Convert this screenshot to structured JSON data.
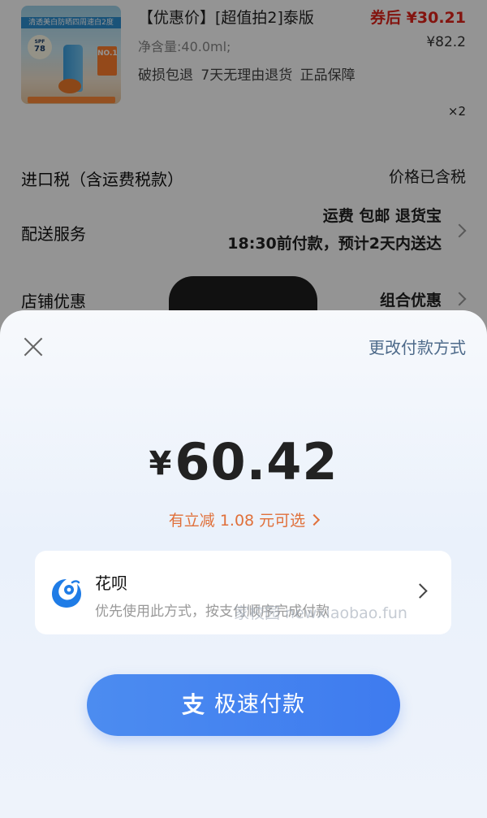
{
  "product": {
    "title": "【优惠价】[超值拍2]泰版",
    "coupon_price": "券后 ¥30.21",
    "spec": "净含量:40.0ml;",
    "price": "¥82.2",
    "guarantees": "破损包退 7天无理由退货 正品保障",
    "quantity": "×2",
    "thumb_banner": "清透美白防晒四周速白2度",
    "thumb_spf": "SPF",
    "thumb_num": "78",
    "thumb_no": "NO.1"
  },
  "rows": {
    "tax_label": "进口税（含运费税款）",
    "tax_value": "价格已含税",
    "delivery_label": "配送服务",
    "delivery_line1": "运费 包邮 退货宝",
    "delivery_line2": "18:30前付款，预计2天内送达",
    "shop_label": "店铺优惠",
    "shop_value": "组合优惠"
  },
  "sheet": {
    "change_method": "更改付款方式",
    "currency": "¥",
    "amount": "60.42",
    "discount": "有立减 1.08 元可选",
    "method_name": "花呗",
    "method_desc": "优先使用此方式，按支付顺序完成付款",
    "watermark": "家校园 newxiaobao.fun",
    "pay_icon": "支",
    "pay_label": "极速付款"
  },
  "colors": {
    "coupon_red": "#e2231a",
    "discount_orange": "#e0703a",
    "pay_blue": "#4080ef",
    "huabei_blue": "#1f7ce6"
  }
}
